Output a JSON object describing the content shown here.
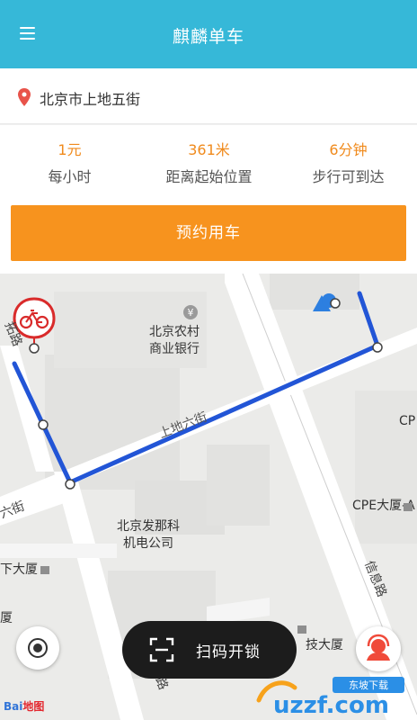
{
  "header": {
    "title": "麒麟单车",
    "menu_icon": "hamburger-menu-icon",
    "background_color": "#36b8d8"
  },
  "location": {
    "icon": "map-pin-icon",
    "icon_color": "#e8534a",
    "address": "北京市上地五街"
  },
  "stats": [
    {
      "value": "1元",
      "label": "每小时"
    },
    {
      "value": "361米",
      "label": "距离起始位置"
    },
    {
      "value": "6分钟",
      "label": "步行可到达"
    }
  ],
  "stats_value_color": "#f08a1c",
  "reserve": {
    "label": "预约用车",
    "color": "#f7931e"
  },
  "map": {
    "labels": {
      "bank": "北京农村\n商业银行",
      "road": "上地六街",
      "company": "北京发那科\n机电公司",
      "cpe": "CPE大厦-A",
      "cp_edge": "CP",
      "xinxi_road": "信息路",
      "left_road_top": "拓路",
      "left_road_bottom": "六街",
      "building_left": "下大厦",
      "building_left2": "厦",
      "building_bottom": "技大厦",
      "bottom_road": "路"
    },
    "route_color": "#2255d6",
    "bike_marker_icon": "bike-marker-icon",
    "bank_icon": "bank-icon",
    "user_location_icon": "user-location-icon"
  },
  "scan": {
    "label": "扫码开锁",
    "icon": "scan-icon"
  },
  "locate_icon": "locate-icon",
  "service_icon": "customer-service-icon",
  "baidu": {
    "brand": "Bai",
    "suffix": "地图"
  },
  "watermark": {
    "text": "uzzf.com",
    "sub": "东坡下载"
  }
}
